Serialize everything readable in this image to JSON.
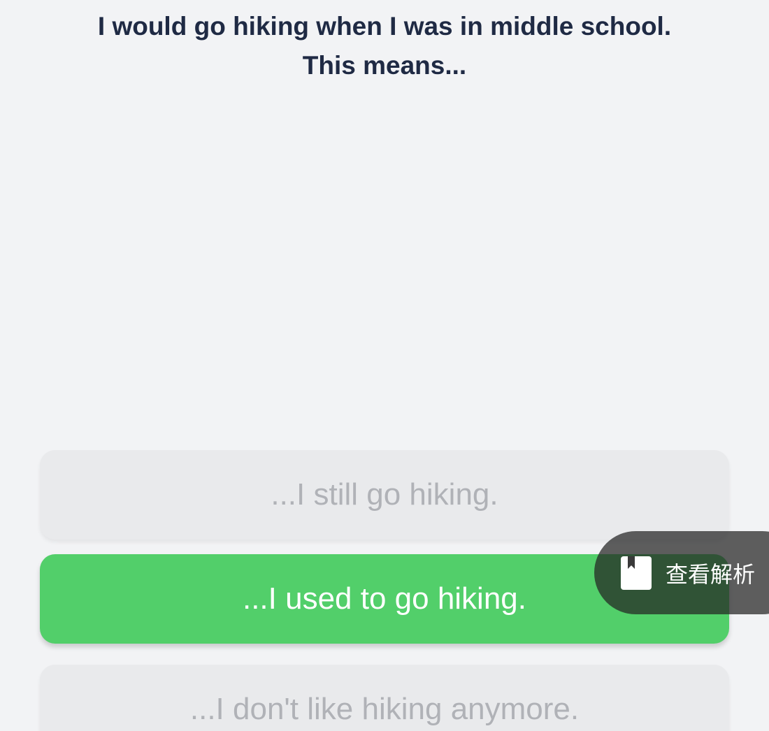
{
  "question": {
    "line1": "I would go hiking when I was in middle school.",
    "line2": "This means..."
  },
  "options": [
    {
      "label": "...I still go hiking.",
      "state": "unselected"
    },
    {
      "label": "...I used to go hiking.",
      "state": "selected"
    },
    {
      "label": "...I don't like hiking anymore.",
      "state": "unselected"
    }
  ],
  "explanation_button": {
    "label": "查看解析",
    "icon": "bookmark-book-icon"
  },
  "colors": {
    "background": "#f2f3f5",
    "question_text": "#1f2a44",
    "selected": "#52cf6a",
    "unselected": "#e9eaec",
    "unselected_text": "#b0b2b7"
  }
}
